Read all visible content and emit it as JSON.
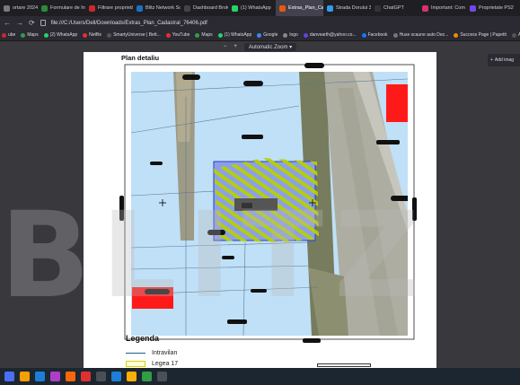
{
  "tabs": [
    {
      "label": "ortare 2024",
      "color": "#7a7a7a"
    },
    {
      "label": "Formulare de înt",
      "color": "#2b8a3e"
    },
    {
      "label": "Filtrare proprietă",
      "color": "#c92a2a"
    },
    {
      "label": "Blitz Network Sol",
      "color": "#1971c2"
    },
    {
      "label": "Dashboard Broke",
      "color": "#444"
    },
    {
      "label": "(1) WhatsApp",
      "color": "#25d366"
    },
    {
      "label": "Extras_Plan_Cadas",
      "color": "#e8590c",
      "active": true
    },
    {
      "label": "Strada Dorului 3",
      "color": "#339af0"
    },
    {
      "label": "ChatGPT",
      "color": "#333"
    },
    {
      "label": "Important: Com",
      "color": "#d6336c"
    },
    {
      "label": "Proprietate PS25",
      "color": "#7048e8"
    }
  ],
  "url": "file:///C:/Users/Dell/Downloads/Extras_Plan_Cadastral_76406.pdf",
  "bookmarks": [
    {
      "label": "ube",
      "color": "#c92a2a"
    },
    {
      "label": "Maps",
      "color": "#2f9e44"
    },
    {
      "label": "(2) WhatsApp",
      "color": "#25d366"
    },
    {
      "label": "Netflix",
      "color": "#e03131"
    },
    {
      "label": "SmartyUniverse | Bett...",
      "color": "#555"
    },
    {
      "label": "YouTube",
      "color": "#e03131"
    },
    {
      "label": "Maps",
      "color": "#2f9e44"
    },
    {
      "label": "(1) WhatsApp",
      "color": "#25d366"
    },
    {
      "label": "Google",
      "color": "#4285f4"
    },
    {
      "label": "logo",
      "color": "#888"
    },
    {
      "label": "danvearth@yahoo.co...",
      "color": "#6741d9"
    },
    {
      "label": "Facebook",
      "color": "#1877f2"
    },
    {
      "label": "Huse scaune auto Dez...",
      "color": "#777"
    },
    {
      "label": "Success Page | Papetti",
      "color": "#f08c00"
    },
    {
      "label": "Alege un proiect",
      "color": "#555"
    }
  ],
  "pdf": {
    "zoom_label": "Automatic Zoom",
    "minus": "−",
    "plus": "+",
    "title": "Plan detaliu",
    "legend_title": "Legenda",
    "legend_items": [
      {
        "label": "Intravilan",
        "color": "#1f5f8b"
      },
      {
        "label": "Legea 17",
        "color": "#cfd600"
      }
    ]
  },
  "add_image_label": "Add imag",
  "watermark_text": "BLITZ",
  "taskbar_colors": [
    "#4c6ef5",
    "#f59f00",
    "#1c7ed6",
    "#ae3ec9",
    "#f76707",
    "#e03131",
    "#495057",
    "#1c7ed6",
    "#fab005",
    "#2f9e44",
    "#495057"
  ]
}
